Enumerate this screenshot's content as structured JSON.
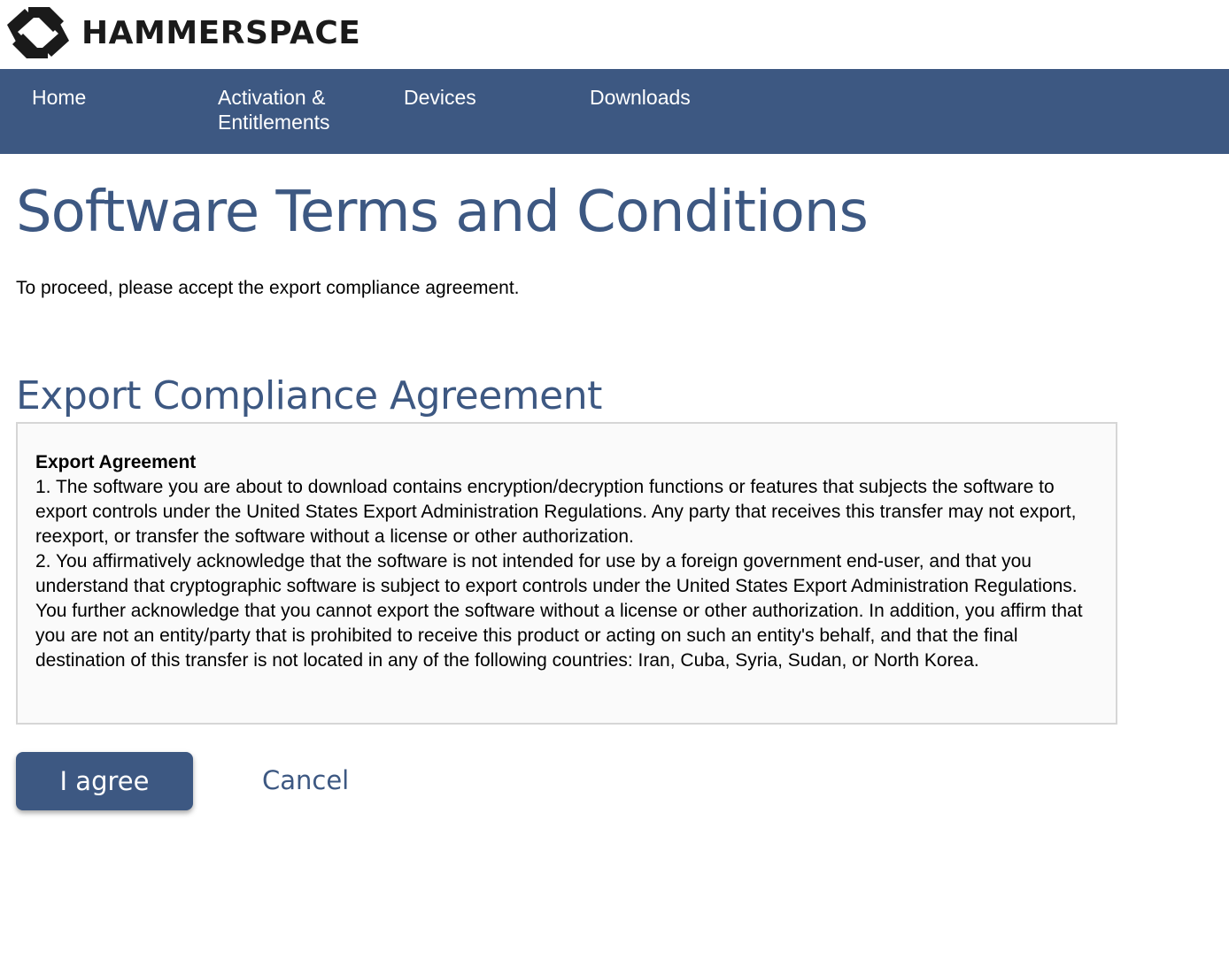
{
  "brand": {
    "logo_icon": "hammerspace-logo-icon",
    "name": "HAMMERSPACE"
  },
  "nav": {
    "items": [
      {
        "label": "Home"
      },
      {
        "label": "Activation & Entitlements"
      },
      {
        "label": "Devices"
      },
      {
        "label": "Downloads"
      }
    ]
  },
  "main": {
    "title": "Software Terms and Conditions",
    "intro": "To proceed, please accept the export compliance agreement.",
    "section_title": "Export Compliance Agreement",
    "agreement": {
      "heading": "Export Agreement",
      "paragraphs": [
        "1. The software you are about to download contains encryption/decryption functions or features that subjects the software to export controls under the United States Export Administration Regulations. Any party that receives this transfer may not export, reexport, or transfer the software without a license or other authorization.",
        "2. You affirmatively acknowledge that the software is not intended for use by a foreign government end-user, and that you understand that cryptographic software is subject to export controls under the United States Export Administration Regulations. You further acknowledge that you cannot export the software without a license or other authorization. In addition, you affirm that you are not an entity/party that is prohibited to receive this product or acting on such an entity's behalf, and that the final destination of this transfer is not located in any of the following countries: Iran, Cuba, Syria, Sudan, or North Korea."
      ]
    },
    "actions": {
      "agree_label": "I agree",
      "cancel_label": "Cancel"
    }
  },
  "colors": {
    "brand_blue": "#3d5882",
    "box_background": "#fafafa",
    "box_border": "#d6d6d6"
  }
}
